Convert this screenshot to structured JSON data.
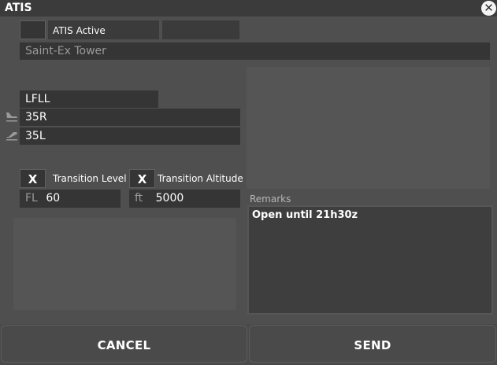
{
  "window": {
    "title": "ATIS"
  },
  "atis": {
    "active_label": "ATIS Active",
    "station_name": "Saint-Ex Tower"
  },
  "airport": {
    "icao": "LFLL",
    "landing_runway": "35R",
    "departure_runway": "35L"
  },
  "transition": {
    "level_toggle": "X",
    "level_label": "Transition Level",
    "altitude_toggle": "X",
    "altitude_label": "Transition Altitude",
    "level_unit": "FL",
    "level_value": "60",
    "altitude_unit": "ft",
    "altitude_value": "5000"
  },
  "remarks": {
    "label": "Remarks",
    "text": "Open until 21h30z"
  },
  "buttons": {
    "cancel": "CANCEL",
    "send": "SEND"
  },
  "icons": {
    "close": "close-icon",
    "landing": "airplane-landing-icon",
    "departure": "airplane-takeoff-icon"
  }
}
